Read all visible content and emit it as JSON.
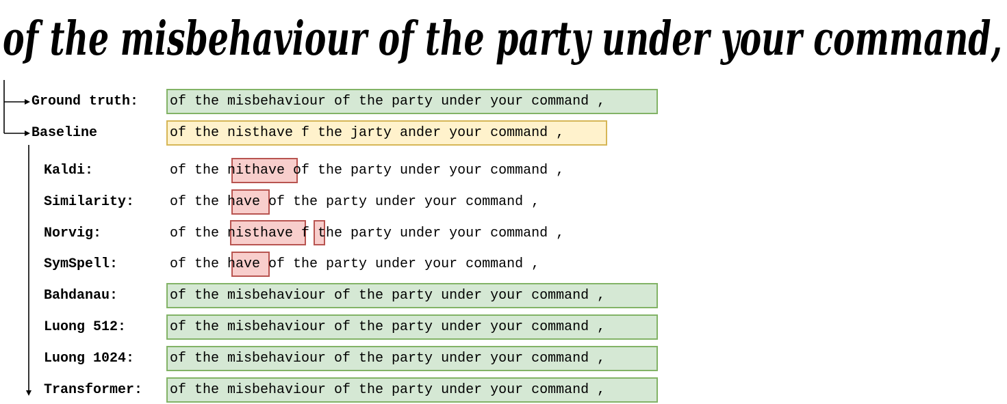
{
  "handwritten_line": "of the misbehaviour of the party under your command,",
  "rows": [
    {
      "label": "Ground truth:",
      "text": "of the misbehaviour of the party under your command ,",
      "style": "green"
    },
    {
      "label": "Baseline",
      "text": "of the nisthave f the jarty ander your command ,",
      "style": "yellow"
    },
    {
      "label": "Kaldi:",
      "text": "of the nithave of the party under your command ,",
      "style": "plain",
      "errors": [
        "nithave"
      ]
    },
    {
      "label": "Similarity:",
      "text": "of the have of the party under your command ,",
      "style": "plain",
      "errors": [
        "have"
      ]
    },
    {
      "label": "Norvig:",
      "text": "of the nisthave f the party under your command ,",
      "style": "plain",
      "errors": [
        "nisthave",
        "f"
      ]
    },
    {
      "label": "SymSpell:",
      "text": "of the have of the party under your command ,",
      "style": "plain",
      "errors": [
        "have"
      ]
    },
    {
      "label": "Bahdanau:",
      "text": "of the misbehaviour of the party under your command ,",
      "style": "green"
    },
    {
      "label": "Luong 512:",
      "text": "of the misbehaviour of the party under your command ,",
      "style": "green"
    },
    {
      "label": "Luong 1024:",
      "text": "of the misbehaviour of the party under your command ,",
      "style": "green"
    },
    {
      "label": "Transformer:",
      "text": "of the misbehaviour of the party under your command ,",
      "style": "green"
    }
  ],
  "colors": {
    "correct_fill": "#d5e8d4",
    "correct_border": "#82b366",
    "baseline_fill": "#fff2cc",
    "baseline_border": "#d6b656",
    "error_fill": "#f8cecc",
    "error_border": "#b85450"
  }
}
